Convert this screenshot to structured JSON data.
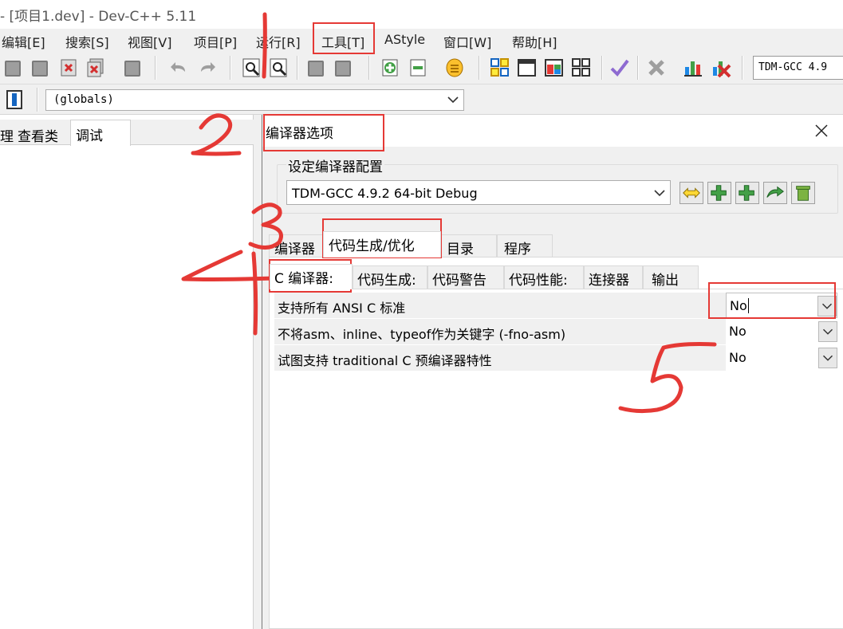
{
  "window": {
    "title": "- [项目1.dev] - Dev-C++ 5.11"
  },
  "menu": [
    {
      "label": "编辑[E]"
    },
    {
      "label": "搜索[S]"
    },
    {
      "label": "视图[V]"
    },
    {
      "label": "项目[P]"
    },
    {
      "label": "运行[R]"
    },
    {
      "label": "工具[T]"
    },
    {
      "label": "AStyle"
    },
    {
      "label": "窗口[W]"
    },
    {
      "label": "帮助[H]"
    }
  ],
  "toolbar": {
    "compiler_combo": "TDM-GCC 4.9"
  },
  "toolbar2": {
    "globals": "(globals)"
  },
  "left_pane": {
    "tabs": [
      {
        "label": "理"
      },
      {
        "label": "查看类"
      },
      {
        "label": "调试"
      }
    ]
  },
  "dialog": {
    "title": "编译器选项",
    "config_group_label": "设定编译器配置",
    "config_value": "TDM-GCC 4.9.2 64-bit Debug",
    "tabs": [
      {
        "label": "编译器"
      },
      {
        "label": "代码生成/优化"
      },
      {
        "label": "目录"
      },
      {
        "label": "程序"
      }
    ],
    "subtabs": [
      {
        "label": "C 编译器:"
      },
      {
        "label": "代码生成:"
      },
      {
        "label": "代码警告"
      },
      {
        "label": "代码性能:"
      },
      {
        "label": "连接器"
      },
      {
        "label": "输出"
      }
    ],
    "options": [
      {
        "label": "支持所有 ANSI C 标准",
        "value": "No"
      },
      {
        "label": "不将asm、inline、typeof作为关键字 (-fno-asm)",
        "value": "No"
      },
      {
        "label": "试图支持 traditional C 预编译器特性",
        "value": "No"
      }
    ]
  },
  "annotations": {
    "color": "#e53935",
    "numbers": [
      "1",
      "2",
      "3",
      "4",
      "5"
    ]
  }
}
